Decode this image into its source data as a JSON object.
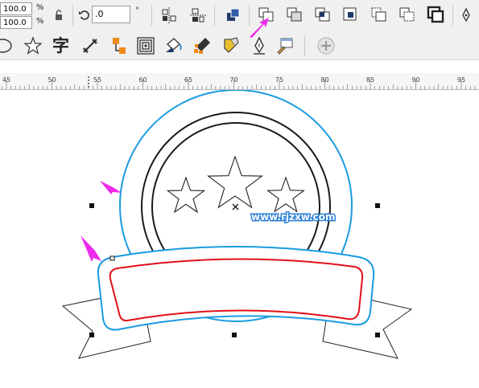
{
  "property_bar": {
    "scale_x_value": "100.0",
    "scale_y_value": "100.0",
    "scale_unit": "%",
    "rotation_value": ".0",
    "rotation_unit": "°"
  },
  "ruler": {
    "labels": [
      "45",
      "50",
      "55",
      "60",
      "65",
      "70",
      "75",
      "80",
      "85",
      "90",
      "95"
    ]
  },
  "canvas": {
    "watermark": "www.rjzxw.com"
  },
  "colors": {
    "outer_circle": "#1a9be0",
    "ribbon_outline": "#1a9be0",
    "ribbon_inner": "#e0101a",
    "arrow": "#ee2aee",
    "stroke_dark": "#1a1a1a"
  }
}
